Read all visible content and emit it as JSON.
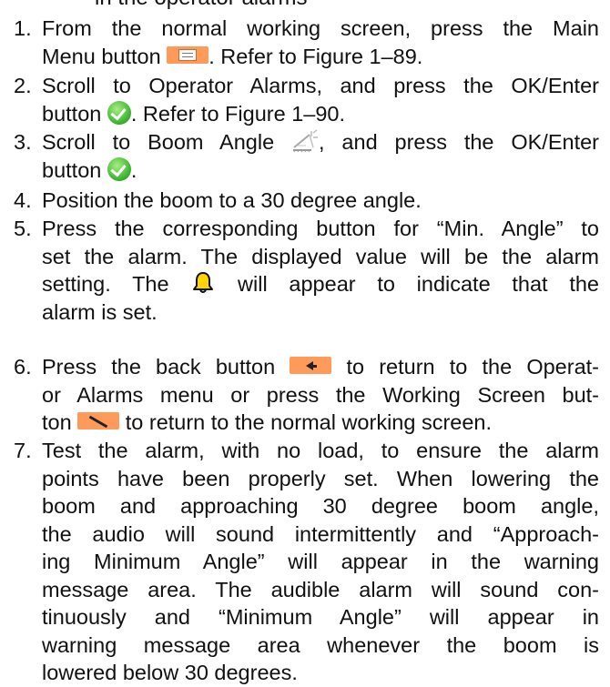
{
  "header": {
    "cut_off_text": "in the operator alarms"
  },
  "steps": [
    {
      "number": "1.",
      "lines": [
        "From the normal working screen, press the Main",
        "Menu button",
        ". Refer to Figure 1–89."
      ]
    },
    {
      "number": "2.",
      "lines": [
        "Scroll to Operator Alarms, and press the OK/Enter",
        "button",
        ". Refer to Figure 1–90."
      ]
    },
    {
      "number": "3.",
      "lines": [
        "Scroll to Boom Angle",
        ", and press the OK/Enter",
        "button",
        "."
      ]
    },
    {
      "number": "4.",
      "lines": [
        "Position the boom to a 30 degree angle."
      ]
    },
    {
      "number": "5.",
      "lines": [
        "Press the corresponding button for “Min. Angle” to",
        "set the alarm.  The displayed value will be the alarm",
        "setting.  The",
        "will appear to indicate that the",
        "alarm is set."
      ]
    },
    {
      "number": "6.",
      "lines": [
        "Press the back button",
        "to return to the Operat-",
        "or Alarms menu or press the Working Screen but-",
        "ton",
        "to return to the normal working screen."
      ]
    },
    {
      "number": "7.",
      "lines": [
        "Test the alarm, with no load, to ensure the alarm",
        "points have been properly set.  When lowering the",
        "boom and approaching 30 degree boom angle,",
        "the audio will sound intermittently and “Approach-",
        "ing Minimum Angle” will appear in the warning",
        "message area.  The audible alarm will sound con-",
        "tinuously and “Minimum Angle” will appear in",
        "warning message area whenever the boom is",
        "lowered below 30 degrees."
      ]
    }
  ],
  "icons": {
    "main_menu": "main-menu-button-icon",
    "ok_enter": "ok-enter-button-icon",
    "boom_angle": "boom-angle-icon",
    "bell": "alarm-bell-icon",
    "back": "back-button-icon",
    "working_screen": "working-screen-button-icon"
  },
  "colors": {
    "key_orange": "#ff9a5a",
    "ok_green": "#36b02c",
    "bell_yellow": "#ffd400"
  }
}
